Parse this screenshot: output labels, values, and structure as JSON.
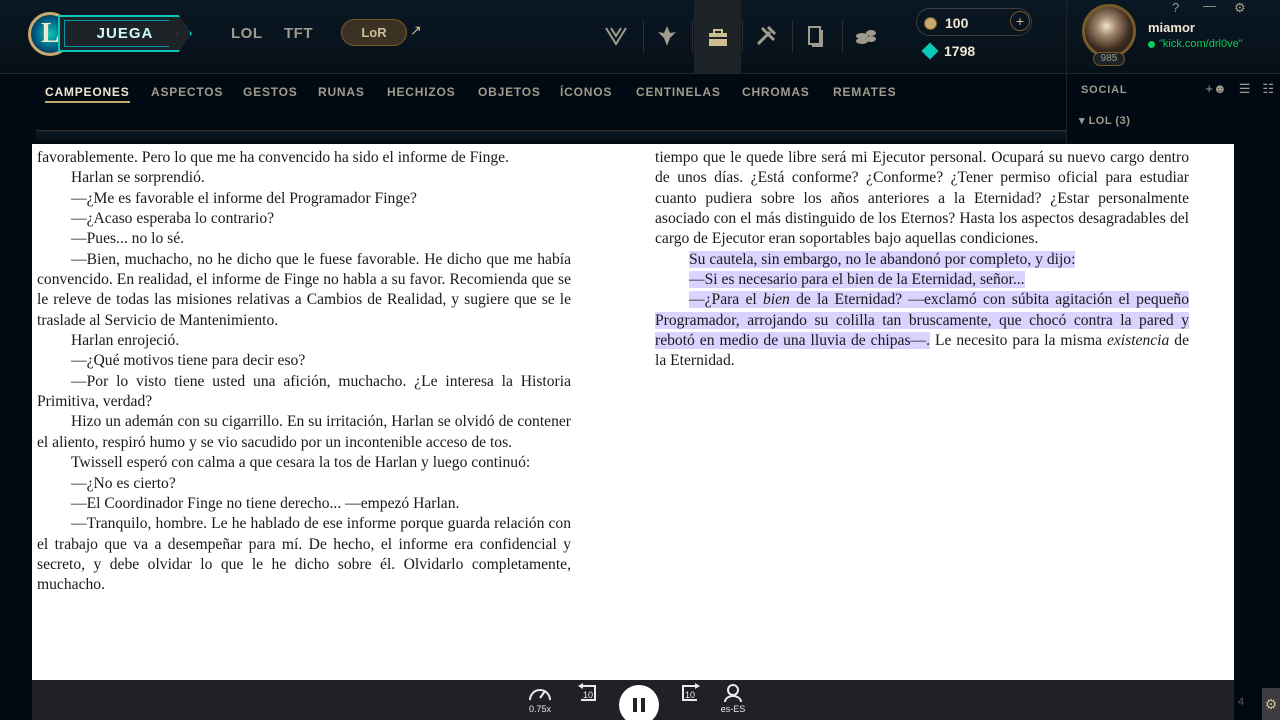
{
  "topbar": {
    "logo_letter": "L",
    "play_label": "JUEGA",
    "links": [
      "LOL",
      "TFT"
    ],
    "lor_label": "LoR",
    "lor_arrow": "↗",
    "nav_icons": [
      "tft-emblem-icon",
      "tactician-icon",
      "store-bag-icon",
      "crafting-icon",
      "collection-cards-icon",
      "loot-icon"
    ],
    "rp": "100",
    "rp_plus": "+",
    "be": "1798",
    "username": "miamor",
    "status": "\"kick.com/drl0ve\"",
    "level": "985",
    "window_buttons": [
      "?",
      "—",
      "⚙"
    ]
  },
  "subnav": {
    "items": [
      "CAMPEONES",
      "ASPECTOS",
      "GESTOS",
      "RUNAS",
      "HECHIZOS",
      "OBJETOS",
      "ÍCONOS",
      "CENTINELAS",
      "CHROMAS",
      "REMATES"
    ],
    "active": 0
  },
  "social": {
    "title": "SOCIAL",
    "group": "▾  LOL (3)"
  },
  "reader": {
    "left": [
      {
        "text": "favorablemente. Pero lo que me ha convencido ha sido el informe de Finge.",
        "indent": false
      },
      {
        "text": "Harlan se sorprendió.",
        "indent": true
      },
      {
        "text": "—¿Me es favorable el informe del Programador Finge?",
        "indent": true
      },
      {
        "text": "—¿Acaso esperaba lo contrario?",
        "indent": true
      },
      {
        "text": "—Pues... no lo sé.",
        "indent": true
      },
      {
        "text": "—Bien, muchacho, no he dicho que le fuese favorable. He dicho que me había convencido. En realidad, el informe de Finge no habla a su favor. Recomienda que se le releve de todas las misiones relativas a Cambios de Realidad, y sugiere que se le traslade al Servicio de Mantenimiento.",
        "indent": true
      },
      {
        "text": "Harlan enrojeció.",
        "indent": true
      },
      {
        "text": "—¿Qué motivos tiene para decir eso?",
        "indent": true
      },
      {
        "text": "—Por lo visto tiene usted una afición, muchacho. ¿Le interesa la Historia Primitiva, verdad?",
        "indent": true
      },
      {
        "text": "Hizo un ademán con su cigarrillo. En su irritación, Harlan se olvidó de contener el aliento, respiró humo y se vio sacudido por un incontenible acceso de tos.",
        "indent": true
      },
      {
        "text": "Twissell esperó con calma a que cesara la tos de Harlan y luego continuó:",
        "indent": true
      },
      {
        "text": "—¿No es cierto?",
        "indent": true
      },
      {
        "text": "—El Coordinador Finge no tiene derecho... —empezó Harlan.",
        "indent": true
      },
      {
        "text": "—Tranquilo, hombre. Le he hablado de ese informe porque guarda relación con el trabajo que va a desempeñar para mí. De hecho, el informe era confidencial y secreto, y debe olvidar lo que le he dicho sobre él. Olvidarlo completamente, muchacho.",
        "indent": true
      }
    ],
    "right_p1": "tiempo que le quede libre será mi Ejecutor personal. Ocupará su nuevo cargo dentro de unos días. ¿Está conforme? ¿Conforme? ¿Tener permiso oficial para estudiar cuanto pudiera sobre los años anteriores a la Eternidad? ¿Estar personalmente asociado con el más distinguido de los Eternos? Hasta los aspectos desagradables del cargo de Ejecutor eran soportables bajo aquellas condiciones.",
    "right_p2": "Su cautela, sin embargo, no le abandonó por completo, y dijo:",
    "right_p3": "—Si es necesario para el bien de la Eternidad, señor...",
    "right_p4_a": "—¿Para el ",
    "right_p4_em": "bien",
    "right_p4_b": " de la Eternidad? —exclamó con súbita agitación el pequeño Programador, arrojando su colilla tan bruscamente, que chocó contra la pared y rebotó en medio de una lluvia de chipas—.",
    "right_p4_c": " Le necesito para la misma ",
    "right_p4_em2": "existencia",
    "right_p4_d": " de la Eternidad."
  },
  "playbar": {
    "speed": "0.75x",
    "rewind": "10",
    "forward": "10",
    "voice": "es-ES"
  },
  "corner": {
    "num": "4",
    "gear": "⚙"
  }
}
